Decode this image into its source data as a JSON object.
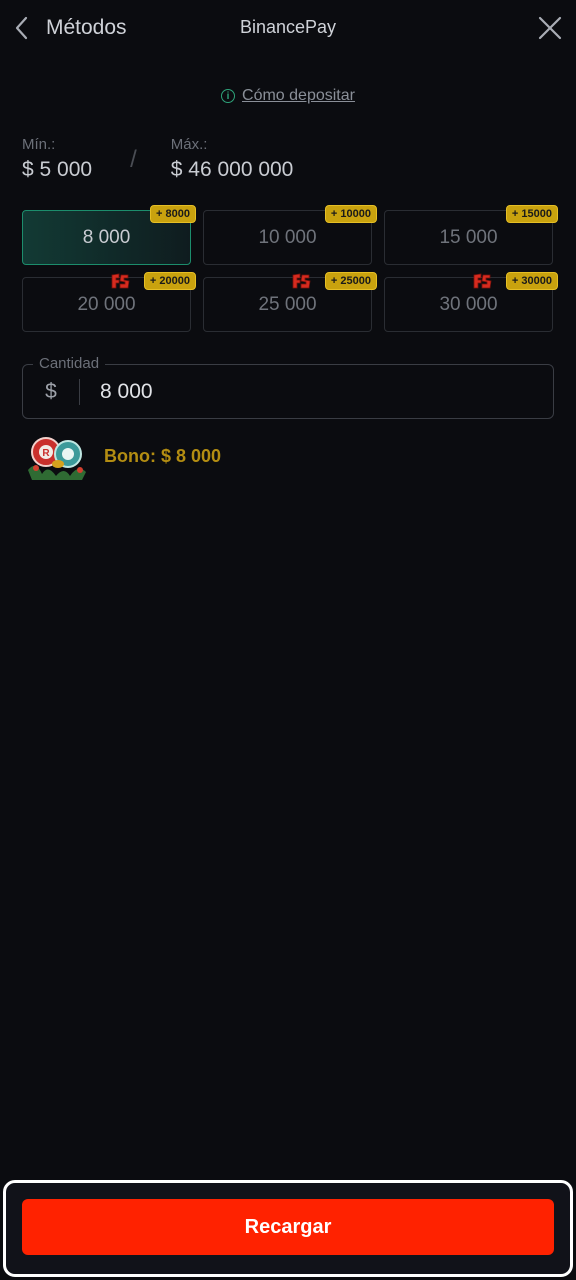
{
  "header": {
    "back_label": "Métodos",
    "title": "BinancePay"
  },
  "how_to_deposit": "Cómo depositar",
  "limits": {
    "min_label": "Mín.:",
    "min_value": "$ 5 000",
    "separator": "/",
    "max_label": "Máx.:",
    "max_value": "$ 46 000 000"
  },
  "amounts": [
    {
      "value": "8 000",
      "bonus": "+ 8000",
      "fs": false,
      "selected": true
    },
    {
      "value": "10 000",
      "bonus": "+ 10000",
      "fs": false,
      "selected": false
    },
    {
      "value": "15 000",
      "bonus": "+ 15000",
      "fs": false,
      "selected": false
    },
    {
      "value": "20 000",
      "bonus": "+ 20000",
      "fs": true,
      "selected": false
    },
    {
      "value": "25 000",
      "bonus": "+ 25000",
      "fs": true,
      "selected": false
    },
    {
      "value": "30 000",
      "bonus": "+ 30000",
      "fs": true,
      "selected": false
    }
  ],
  "amount_field": {
    "label": "Cantidad",
    "currency": "$",
    "value": "8 000"
  },
  "bonus": "Bono: $ 8 000",
  "submit_label": "Recargar",
  "colors": {
    "accent_green": "#1c8d6c",
    "badge_gold": "#c9a20e",
    "bonus_text": "#b38d12",
    "cta_red": "#ff2200",
    "background": "#0b0c10"
  },
  "icons": {
    "back": "chevron-left-icon",
    "close": "close-icon",
    "info": "info-icon",
    "free_spins": "fs-icon",
    "bonus_art": "bonus-chips-icon"
  }
}
